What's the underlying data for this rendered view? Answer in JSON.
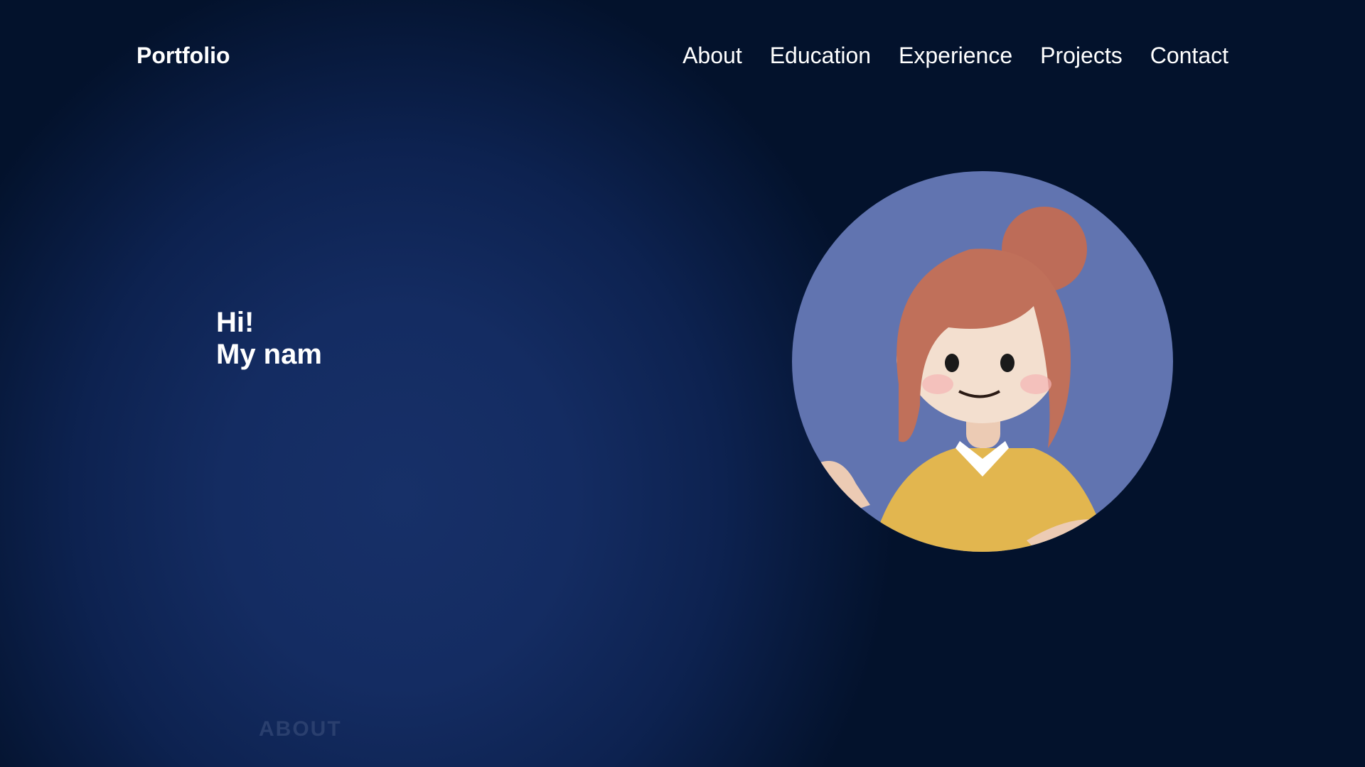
{
  "header": {
    "logo": "Portfolio",
    "nav": [
      {
        "label": "About"
      },
      {
        "label": "Education"
      },
      {
        "label": "Experience"
      },
      {
        "label": "Projects"
      },
      {
        "label": "Contact"
      }
    ]
  },
  "hero": {
    "line1": "Hi!",
    "line2": "My nam"
  },
  "next_section": {
    "title": "ABOUT"
  },
  "colors": {
    "avatar_bg": "#6174b0",
    "hair": "#c0705a",
    "shirt": "#e2b64f"
  }
}
